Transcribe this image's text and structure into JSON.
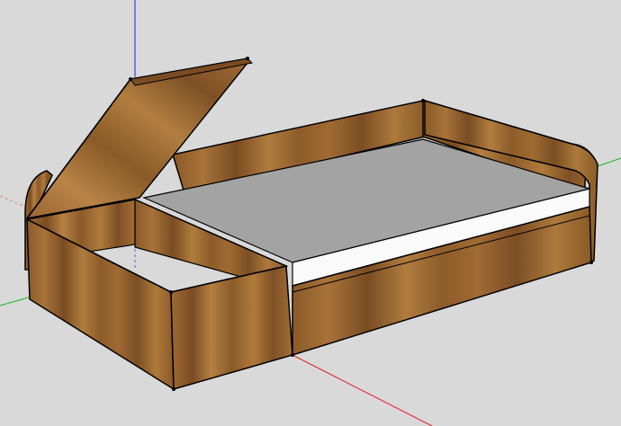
{
  "scene": {
    "background": "#d9d9d9",
    "colors": {
      "wood_dark": "#6e4420",
      "wood_mid": "#97652f",
      "wood_light": "#b07a3b",
      "mattress_top": "#a3a3a3",
      "mattress_side": "#fafafa",
      "edge": "#000000",
      "axis_red": "#e02020",
      "axis_green": "#20b020",
      "axis_blue": "#2020e0"
    },
    "objects": [
      "axis-blue-vertical",
      "axis-red",
      "axis-green",
      "bed-back-panel",
      "bed-right-end-panel",
      "bed-left-end-panel",
      "storage-box",
      "storage-box-lid",
      "mattress",
      "bed-front-drawer-panel"
    ]
  }
}
